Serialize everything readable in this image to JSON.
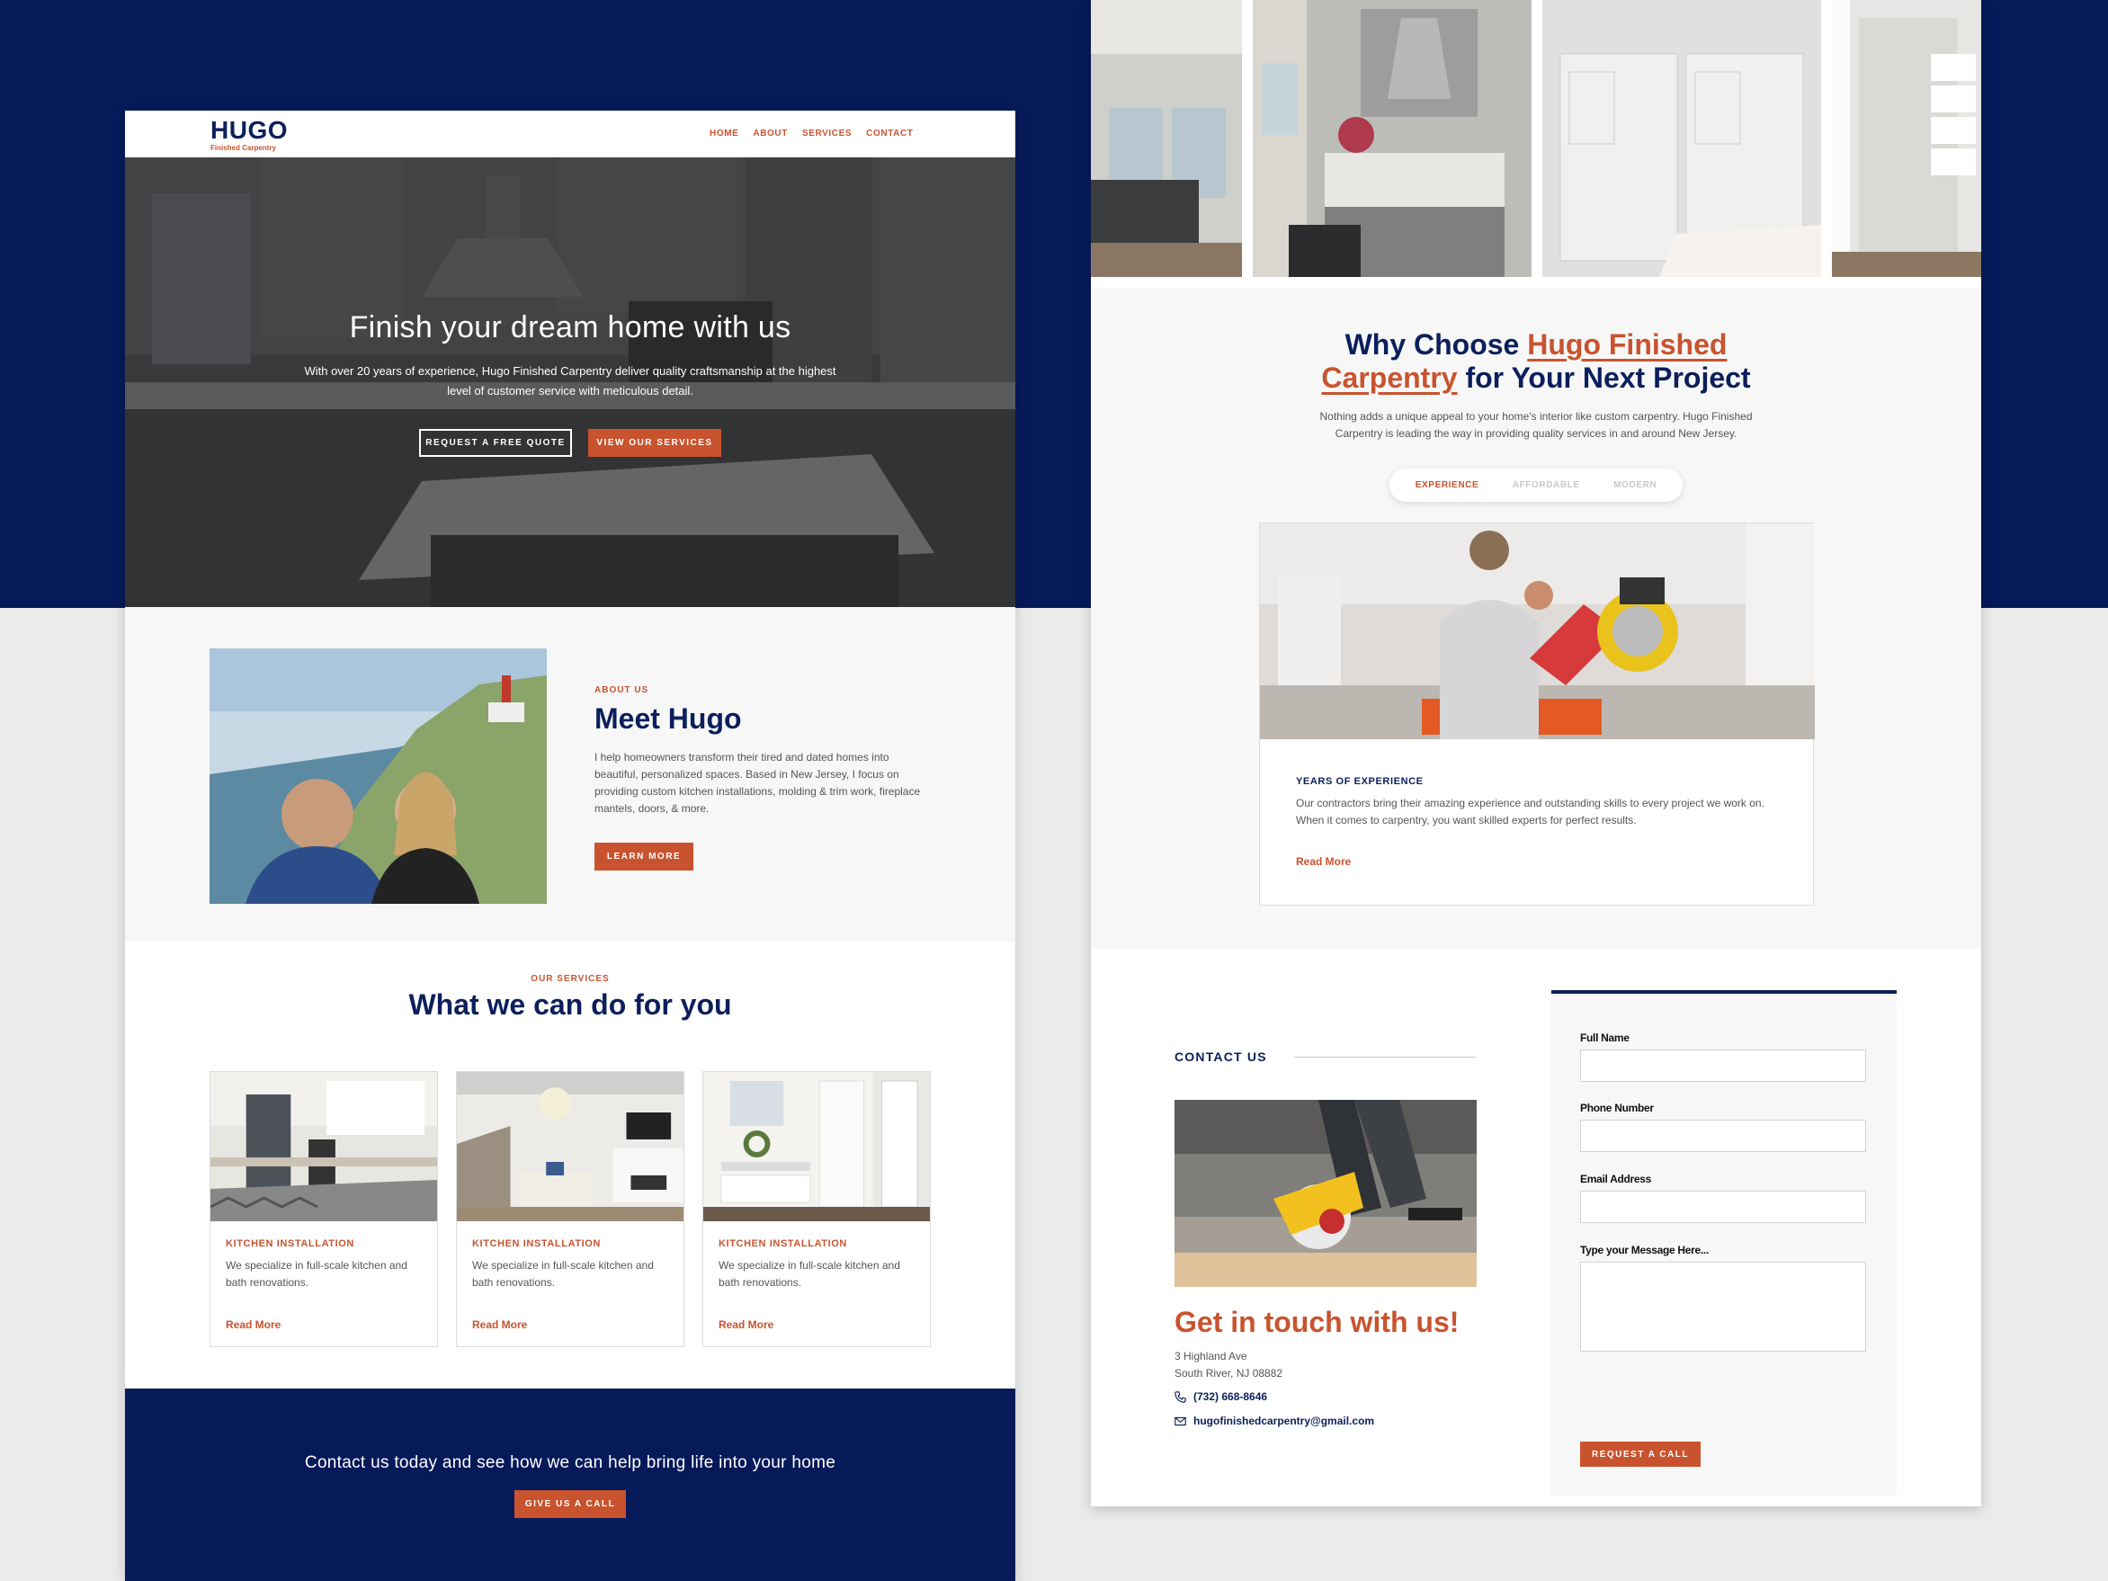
{
  "colors": {
    "navy": "#0c1f5c",
    "orange": "#c9532e",
    "background_top": "#061a5a",
    "background_bottom": "#ebebeb"
  },
  "header": {
    "logo_name": "HUGO",
    "logo_sub": "Finished Carpentry",
    "nav": [
      {
        "label": "HOME"
      },
      {
        "label": "ABOUT"
      },
      {
        "label": "SERVICES"
      },
      {
        "label": "CONTACT"
      }
    ]
  },
  "hero": {
    "title": "Finish your dream home with us",
    "subtitle": "With over 20 years of experience, Hugo Finished Carpentry deliver quality craftsmanship at the highest level of customer service with meticulous detail.",
    "btn_quote": "REQUEST A FREE QUOTE",
    "btn_services": "VIEW OUR SERVICES"
  },
  "about": {
    "kicker": "ABOUT US",
    "title": "Meet Hugo",
    "text": "I help homeowners transform their tired and dated homes into beautiful, personalized spaces. Based in New Jersey, I focus on providing custom kitchen installations, molding & trim work, fireplace mantels, doors, & more.",
    "btn": "LEARN MORE"
  },
  "services": {
    "kicker": "OUR SERVICES",
    "title": "What we can do for you",
    "cards": [
      {
        "title": "KITCHEN INSTALLATION",
        "text": "We specialize in full-scale kitchen and bath renovations.",
        "more": "Read More"
      },
      {
        "title": "KITCHEN INSTALLATION",
        "text": "We specialize in full-scale kitchen and bath renovations.",
        "more": "Read More"
      },
      {
        "title": "KITCHEN INSTALLATION",
        "text": "We specialize in full-scale kitchen and bath renovations.",
        "more": "Read More"
      }
    ]
  },
  "cta": {
    "text": "Contact us today and see how we can help bring life into your home",
    "btn": "GIVE US A CALL"
  },
  "why": {
    "title_pre": "Why Choose ",
    "title_highlight_1": "Hugo Finished",
    "title_highlight_2": "Carpentry",
    "title_post": " for Your Next Project",
    "text": "Nothing adds a unique appeal to your home's interior like custom carpentry. Hugo Finished Carpentry is leading the way in providing quality services in and around New Jersey.",
    "tabs": [
      {
        "label": "EXPERIENCE",
        "active": true
      },
      {
        "label": "AFFORDABLE",
        "active": false
      },
      {
        "label": "MODERN",
        "active": false
      }
    ],
    "card_title": "YEARS OF EXPERIENCE",
    "card_text": "Our contractors bring their amazing experience and outstanding skills to every project we work on. When it comes to carpentry, you want skilled experts for perfect results.",
    "card_more": "Read More"
  },
  "contact": {
    "heading": "CONTACT US",
    "title": "Get in touch with us!",
    "address_1": "3 Highland Ave",
    "address_2": "South River, NJ 08882",
    "phone": "(732) 668-8646",
    "email": "hugofinishedcarpentry@gmail.com",
    "form": {
      "full_name": "Full Name",
      "phone": "Phone Number",
      "email": "Email Address",
      "message": "Type your Message Here...",
      "submit": "REQUEST A CALL"
    }
  }
}
